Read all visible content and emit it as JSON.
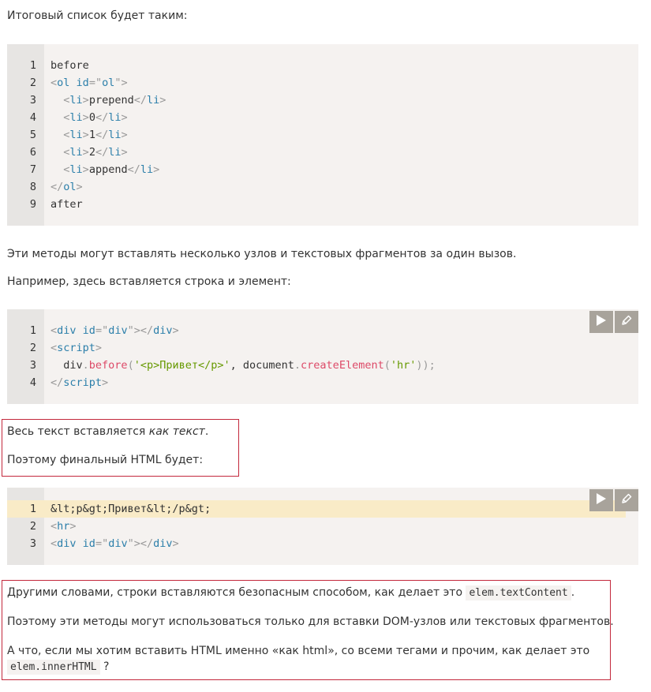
{
  "intro": "Итоговый список будет таким:",
  "code1": {
    "numbers": [
      "1",
      "2",
      "3",
      "4",
      "5",
      "6",
      "7",
      "8",
      "9"
    ],
    "lines": [
      [
        {
          "t": "before",
          "c": "pl"
        }
      ],
      [
        {
          "t": "<",
          "c": "pu"
        },
        {
          "t": "ol",
          "c": "tg"
        },
        {
          "t": " ",
          "c": "pl"
        },
        {
          "t": "id",
          "c": "at"
        },
        {
          "t": "=\"",
          "c": "pu"
        },
        {
          "t": "ol",
          "c": "av"
        },
        {
          "t": "\">",
          "c": "pu"
        }
      ],
      [
        {
          "t": "  ",
          "c": "pl"
        },
        {
          "t": "<",
          "c": "pu"
        },
        {
          "t": "li",
          "c": "tg"
        },
        {
          "t": ">",
          "c": "pu"
        },
        {
          "t": "prepend",
          "c": "pl"
        },
        {
          "t": "</",
          "c": "pu"
        },
        {
          "t": "li",
          "c": "tg"
        },
        {
          "t": ">",
          "c": "pu"
        }
      ],
      [
        {
          "t": "  ",
          "c": "pl"
        },
        {
          "t": "<",
          "c": "pu"
        },
        {
          "t": "li",
          "c": "tg"
        },
        {
          "t": ">",
          "c": "pu"
        },
        {
          "t": "0",
          "c": "pl"
        },
        {
          "t": "</",
          "c": "pu"
        },
        {
          "t": "li",
          "c": "tg"
        },
        {
          "t": ">",
          "c": "pu"
        }
      ],
      [
        {
          "t": "  ",
          "c": "pl"
        },
        {
          "t": "<",
          "c": "pu"
        },
        {
          "t": "li",
          "c": "tg"
        },
        {
          "t": ">",
          "c": "pu"
        },
        {
          "t": "1",
          "c": "pl"
        },
        {
          "t": "</",
          "c": "pu"
        },
        {
          "t": "li",
          "c": "tg"
        },
        {
          "t": ">",
          "c": "pu"
        }
      ],
      [
        {
          "t": "  ",
          "c": "pl"
        },
        {
          "t": "<",
          "c": "pu"
        },
        {
          "t": "li",
          "c": "tg"
        },
        {
          "t": ">",
          "c": "pu"
        },
        {
          "t": "2",
          "c": "pl"
        },
        {
          "t": "</",
          "c": "pu"
        },
        {
          "t": "li",
          "c": "tg"
        },
        {
          "t": ">",
          "c": "pu"
        }
      ],
      [
        {
          "t": "  ",
          "c": "pl"
        },
        {
          "t": "<",
          "c": "pu"
        },
        {
          "t": "li",
          "c": "tg"
        },
        {
          "t": ">",
          "c": "pu"
        },
        {
          "t": "append",
          "c": "pl"
        },
        {
          "t": "</",
          "c": "pu"
        },
        {
          "t": "li",
          "c": "tg"
        },
        {
          "t": ">",
          "c": "pu"
        }
      ],
      [
        {
          "t": "</",
          "c": "pu"
        },
        {
          "t": "ol",
          "c": "tg"
        },
        {
          "t": ">",
          "c": "pu"
        }
      ],
      [
        {
          "t": "after",
          "c": "pl"
        }
      ]
    ]
  },
  "para_methods": "Эти методы могут вставлять несколько узлов и текстовых фрагментов за один вызов.",
  "para_example": "Например, здесь вставляется строка и элемент:",
  "code2": {
    "numbers": [
      "1",
      "2",
      "3",
      "4"
    ],
    "lines": [
      [
        {
          "t": "<",
          "c": "pu"
        },
        {
          "t": "div",
          "c": "tg"
        },
        {
          "t": " ",
          "c": "pl"
        },
        {
          "t": "id",
          "c": "at"
        },
        {
          "t": "=\"",
          "c": "pu"
        },
        {
          "t": "div",
          "c": "av"
        },
        {
          "t": "\"></",
          "c": "pu"
        },
        {
          "t": "div",
          "c": "tg"
        },
        {
          "t": ">",
          "c": "pu"
        }
      ],
      [
        {
          "t": "<",
          "c": "pu"
        },
        {
          "t": "script",
          "c": "tg"
        },
        {
          "t": ">",
          "c": "pu"
        }
      ],
      [
        {
          "t": "  div",
          "c": "pl"
        },
        {
          "t": ".",
          "c": "pu"
        },
        {
          "t": "before",
          "c": "fn"
        },
        {
          "t": "(",
          "c": "pu"
        },
        {
          "t": "'<p>Привет</p>'",
          "c": "sv"
        },
        {
          "t": ", document",
          "c": "pl"
        },
        {
          "t": ".",
          "c": "pu"
        },
        {
          "t": "createElement",
          "c": "fn"
        },
        {
          "t": "(",
          "c": "pu"
        },
        {
          "t": "'hr'",
          "c": "sv"
        },
        {
          "t": "));",
          "c": "pu"
        }
      ],
      [
        {
          "t": "</",
          "c": "pu"
        },
        {
          "t": "script",
          "c": "tg"
        },
        {
          "t": ">",
          "c": "pu"
        }
      ]
    ]
  },
  "box1": {
    "line1_before": "Весь текст вставляется ",
    "line1_em": "как текст",
    "line1_after": ".",
    "line2": "Поэтому финальный HTML будет:"
  },
  "code3": {
    "numbers": [
      "1",
      "2",
      "3"
    ],
    "lines": [
      [
        {
          "t": "&lt;p&gt;Привет&lt;/p&gt;",
          "c": "pl"
        }
      ],
      [
        {
          "t": "<",
          "c": "pu"
        },
        {
          "t": "hr",
          "c": "tg"
        },
        {
          "t": ">",
          "c": "pu"
        }
      ],
      [
        {
          "t": "<",
          "c": "pu"
        },
        {
          "t": "div",
          "c": "tg"
        },
        {
          "t": " ",
          "c": "pl"
        },
        {
          "t": "id",
          "c": "at"
        },
        {
          "t": "=\"",
          "c": "pu"
        },
        {
          "t": "div",
          "c": "av"
        },
        {
          "t": "\"></",
          "c": "pu"
        },
        {
          "t": "div",
          "c": "tg"
        },
        {
          "t": ">",
          "c": "pu"
        }
      ]
    ]
  },
  "box2": {
    "p1_before": "Другими словами, строки вставляются безопасным способом, как делает это ",
    "p1_code": "elem.textContent",
    "p1_after": ".",
    "p2": "Поэтому эти методы могут использоваться только для вставки DOM-узлов или текстовых фрагментов.",
    "p3_before": "А что, если мы хотим вставить HTML именно «как html», со всеми тегами и прочим, как делает это",
    "p3_code": "elem.innerHTML",
    "p3_after": "?"
  },
  "icons": {
    "run": "play-icon",
    "edit": "pencil-icon"
  },
  "colors": {
    "code_bg": "#f5f2f0",
    "gutter_bg": "#e7e5e3",
    "highlight_bg": "#f9ebc7",
    "box_border": "#c3283c",
    "button_bg": "#a8a39b"
  }
}
